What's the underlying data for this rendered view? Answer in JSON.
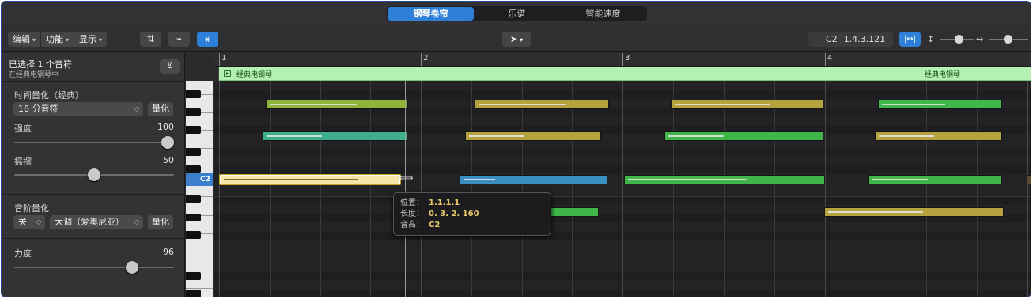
{
  "tabs": [
    {
      "label": "钢琴卷帘",
      "active": true
    },
    {
      "label": "乐谱",
      "active": false
    },
    {
      "label": "智能速度",
      "active": false
    }
  ],
  "toolbar": {
    "menus": [
      "编辑",
      "功能",
      "显示"
    ],
    "position_display": {
      "pitch": "C2",
      "position": "1.4.3.121"
    }
  },
  "inspector": {
    "selection_title": "已选择 1 个音符",
    "selection_subtitle": "在经典电钢琴中",
    "time_quantize_label": "时间量化（经典）",
    "time_quantize_value": "16 分音符",
    "quantize_button": "量化",
    "strength_label": "强度",
    "strength_value": "100",
    "strength_level": 1.0,
    "swing_label": "摇摆",
    "swing_value": "50",
    "swing_level": 0.5,
    "scale_quantize_label": "音阶量化",
    "scale_root_value": "关",
    "scale_type_value": "大调（爱奥尼亚）",
    "scale_quantize_button": "量化",
    "velocity_label": "力度",
    "velocity_value": "96",
    "velocity_level": 0.76
  },
  "keyboard": {
    "c_label": "C2"
  },
  "ruler": {
    "bars": [
      "1",
      "2",
      "3",
      "4"
    ]
  },
  "region": {
    "name": "经典电钢琴",
    "name_repeat": "经典电钢琴",
    "color": "#b4f0b2"
  },
  "tooltip": {
    "position_label": "位置：",
    "position_value": "1.1.1.1",
    "length_label": "长度：",
    "length_value": "0. 3. 2. 160",
    "pitch_label": "音高：",
    "pitch_value": "C2"
  },
  "colors": {
    "accent": "#2d7fd8",
    "note_lime": "#8fb43a",
    "note_olive": "#b5a23e",
    "note_teal": "#3fae8c",
    "note_green": "#3fb54a",
    "note_blue": "#3a8fc2",
    "note_selected": "#f5e6a8"
  }
}
